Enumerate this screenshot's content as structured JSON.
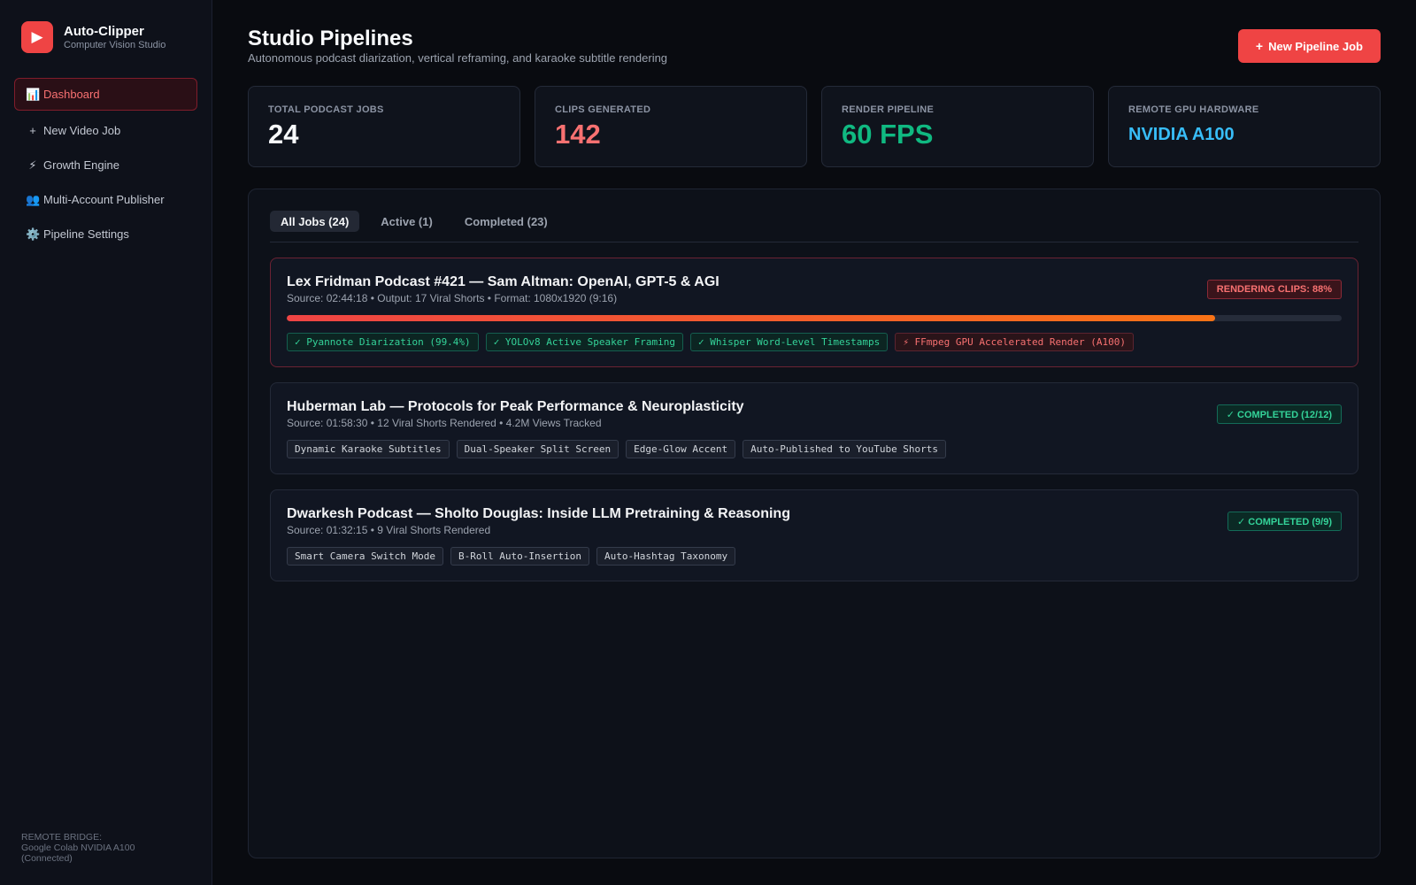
{
  "app": {
    "logo_glyph": "▶",
    "name": "Auto-Clipper",
    "subtitle": "Computer Vision Studio"
  },
  "sidebar": {
    "items": [
      {
        "icon": "📊",
        "label": "Dashboard",
        "active": true
      },
      {
        "icon": "+",
        "label": "New Video Job"
      },
      {
        "icon": "⚡",
        "label": "Growth Engine"
      },
      {
        "icon": "👥",
        "label": "Multi-Account Publisher"
      },
      {
        "icon": "⚙️",
        "label": "Pipeline Settings"
      }
    ],
    "bridge_label": "REMOTE BRIDGE:",
    "bridge_value": "Google Colab NVIDIA A100",
    "bridge_status": "(Connected)"
  },
  "header": {
    "title": "Studio Pipelines",
    "subtitle": "Autonomous podcast diarization, vertical reframing, and karaoke subtitle rendering",
    "new_button_icon": "+",
    "new_button_label": "New Pipeline Job"
  },
  "stats": [
    {
      "label": "TOTAL PODCAST JOBS",
      "value": "24",
      "color": "#f8fafc"
    },
    {
      "label": "CLIPS GENERATED",
      "value": "142",
      "color": "#f87171"
    },
    {
      "label": "RENDER PIPELINE",
      "value": "60 FPS",
      "color": "#10b981"
    },
    {
      "label": "REMOTE GPU HARDWARE",
      "value": "NVIDIA A100",
      "color": "#38bdf8"
    }
  ],
  "tabs": [
    {
      "label": "All Jobs (24)",
      "active": true
    },
    {
      "label": "Active (1)"
    },
    {
      "label": "Completed (23)"
    }
  ],
  "jobs": [
    {
      "title": "Lex Fridman Podcast #421 — Sam Altman: OpenAI, GPT-5 & AGI",
      "meta": "Source: 02:44:18 • Output: 17 Viral Shorts • Format: 1080x1920 (9:16)",
      "status": "RENDERING CLIPS: 88%",
      "progress_percent": 88,
      "tags": [
        "✓ Pyannote Diarization (99.4%)",
        "✓ YOLOv8 Active Speaker Framing",
        "✓ Whisper Word-Level Timestamps",
        "⚡ FFmpeg GPU Accelerated Render (A100)"
      ]
    },
    {
      "title": "Huberman Lab — Protocols for Peak Performance & Neuroplasticity",
      "meta": "Source: 01:58:30 • 12 Viral Shorts Rendered • 4.2M Views Tracked",
      "status": "✓ COMPLETED (12/12)",
      "tags": [
        "Dynamic Karaoke Subtitles",
        "Dual-Speaker Split Screen",
        "Edge-Glow Accent",
        "Auto-Published to YouTube Shorts"
      ]
    },
    {
      "title": "Dwarkesh Podcast — Sholto Douglas: Inside LLM Pretraining & Reasoning",
      "meta": "Source: 01:32:15 • 9 Viral Shorts Rendered",
      "status": "✓ COMPLETED (9/9)",
      "tags": [
        "Smart Camera Switch Mode",
        "B-Roll Auto-Insertion",
        "Auto-Hashtag Taxonomy"
      ]
    }
  ]
}
